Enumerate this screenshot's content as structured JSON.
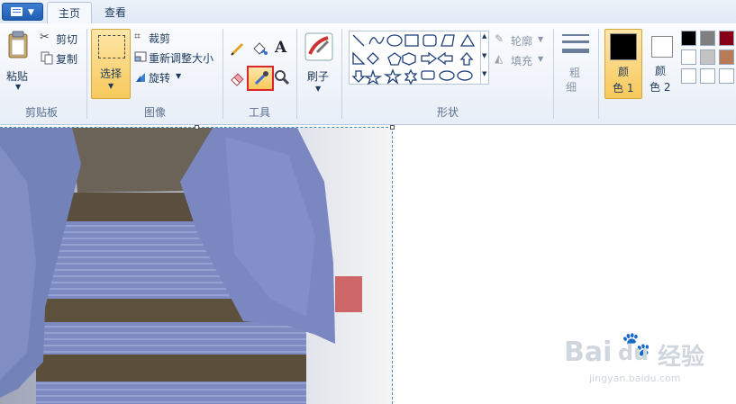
{
  "tabs": [
    {
      "label": "主页"
    },
    {
      "label": "查看"
    }
  ],
  "clipboard": {
    "paste": "粘贴",
    "cut": "剪切",
    "copy": "复制",
    "group": "剪贴板"
  },
  "image": {
    "select": "选择",
    "crop": "裁剪",
    "resize": "重新调整大小",
    "rotate": "旋转",
    "group": "图像"
  },
  "tools": {
    "group": "工具"
  },
  "brush": {
    "label": "刷子"
  },
  "shapes": {
    "outline": "轮廓",
    "fill": "填充",
    "group": "形状"
  },
  "size": {
    "line1": "粗",
    "line2": "细"
  },
  "color1": {
    "line1": "颜",
    "line2": "色 1"
  },
  "color2": {
    "line1": "颜",
    "line2": "色 2"
  },
  "palette": [
    "#000000",
    "#7f7f7f",
    "#880015",
    "#ffffff",
    "#c3c3c3",
    "#b97a57",
    "#ffffff",
    "#ffffff",
    "#ffffff"
  ],
  "watermark": {
    "brand": "Bai",
    "brand2": "du",
    "brand3": "经验",
    "url": "jingyan.baidu.com"
  }
}
